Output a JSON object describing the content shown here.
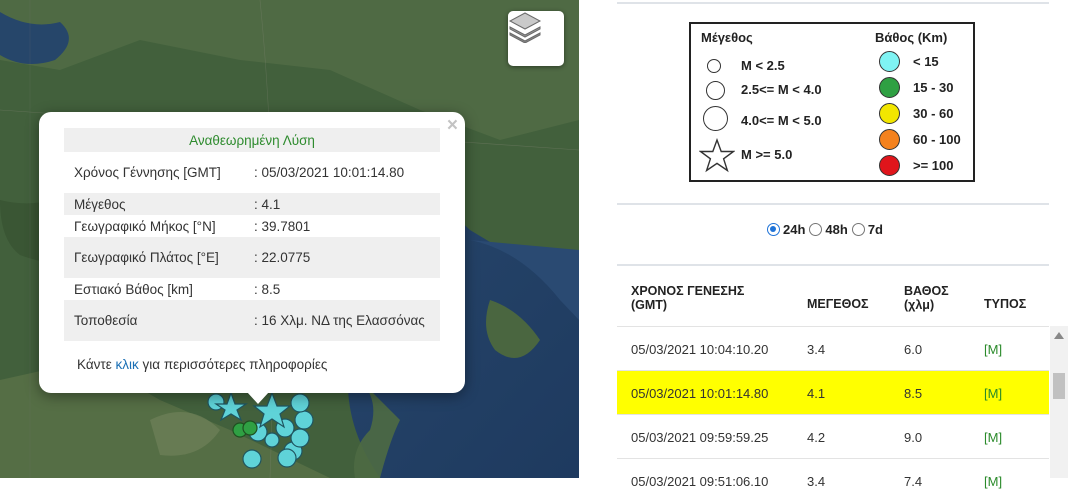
{
  "map": {
    "layers_icon": "layers-icon",
    "close_icon": "close-icon",
    "popup": {
      "title": "Αναθεωρημένη Λύση",
      "rows": [
        {
          "label": "Χρόνος Γέννησης [GMT]",
          "value": ": 05/03/2021 10:01:14.80"
        },
        {
          "label": "Μέγεθος",
          "value": ": 4.1"
        },
        {
          "label": "Γεωγραφικό Μήκος [°N]",
          "value": ": 39.7801"
        },
        {
          "label": "Γεωγραφικό Πλάτος [°E]",
          "value": ": 22.0775"
        },
        {
          "label": "Εστιακό Βάθος [km]",
          "value": ": 8.5"
        },
        {
          "label": "Τοποθεσία",
          "value": ": 16 Χλμ. ΝΔ της Ελασσόνας"
        }
      ],
      "footer_prefix": "Κάντε",
      "footer_link": "κλικ",
      "footer_suffix": "για περισσότερες πληροφορίες"
    }
  },
  "legend": {
    "size_title": "Μέγεθος",
    "size_items": [
      "M < 2.5",
      "2.5<= M < 4.0",
      "4.0<= M < 5.0",
      "M >= 5.0"
    ],
    "depth_title": "Βάθος (Km)",
    "depth_items": [
      {
        "label": "< 15",
        "color": "#7ff3f3"
      },
      {
        "label": "15 - 30",
        "color": "#2fa043"
      },
      {
        "label": "30 - 60",
        "color": "#f2e600"
      },
      {
        "label": "60 - 100",
        "color": "#f4821e"
      },
      {
        "label": ">= 100",
        "color": "#e0151b"
      }
    ]
  },
  "period": {
    "options": [
      "24h",
      "48h",
      "7d"
    ],
    "selected": "24h"
  },
  "table": {
    "headers": [
      "ΧΡΟΝΟΣ ΓΕΝΕΣΗΣ (GMT)",
      "ΜΕΓΕΘΟΣ",
      "ΒΑΘΟΣ (χλμ)",
      "ΤΥΠΟΣ"
    ],
    "rows": [
      {
        "time": "05/03/2021 10:04:10.20",
        "mag": "3.4",
        "depth": "6.0",
        "type": "[M]"
      },
      {
        "time": "05/03/2021 10:01:14.80",
        "mag": "4.1",
        "depth": "8.5",
        "type": "[M]"
      },
      {
        "time": "05/03/2021 09:59:59.25",
        "mag": "4.2",
        "depth": "9.0",
        "type": "[M]"
      },
      {
        "time": "05/03/2021 09:51:06.10",
        "mag": "3.4",
        "depth": "7.4",
        "type": "[M]"
      }
    ],
    "selected_row_color": "#ffff00"
  }
}
